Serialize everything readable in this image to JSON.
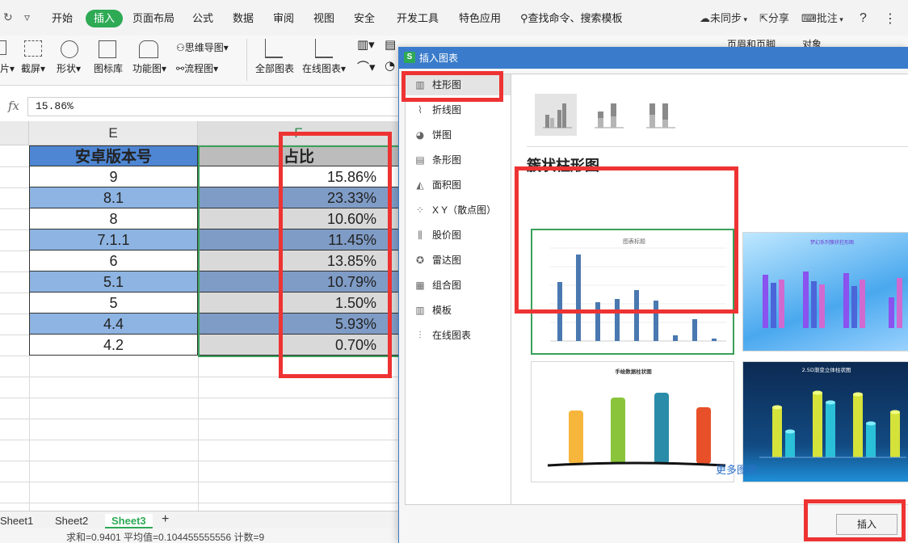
{
  "menubar": {
    "tabs": [
      "开始",
      "插入",
      "页面布局",
      "公式",
      "数据",
      "审阅",
      "视图",
      "安全",
      "开发工具",
      "特色应用"
    ],
    "active_tab": "插入",
    "search": "查找命令、搜索模板",
    "sync": "未同步",
    "share": "分享",
    "comment": "批注",
    "help": "?"
  },
  "ribbon": {
    "screenshot": "截屏",
    "shapes": "形状",
    "icon_library": "图标库",
    "function_chart": "功能图",
    "mindmap": "思维导图",
    "flowchart": "流程图",
    "all_charts": "全部图表",
    "online_charts": "在线图表",
    "header_footer": "页眉和页脚",
    "object": "对象"
  },
  "formula": {
    "fx": "fx",
    "value": "15.86%"
  },
  "sheet": {
    "col_e": "E",
    "col_f": "F",
    "header_e": "安卓版本号",
    "header_f": "占比",
    "rows": [
      {
        "version": "9",
        "pct": "15.86%"
      },
      {
        "version": "8.1",
        "pct": "23.33%"
      },
      {
        "version": "8",
        "pct": "10.60%"
      },
      {
        "version": "7.1.1",
        "pct": "11.45%"
      },
      {
        "version": "6",
        "pct": "13.85%"
      },
      {
        "version": "5.1",
        "pct": "10.79%"
      },
      {
        "version": "5",
        "pct": "1.50%"
      },
      {
        "version": "4.4",
        "pct": "5.93%"
      },
      {
        "version": "4.2",
        "pct": "0.70%"
      }
    ],
    "tabs": [
      "Sheet1",
      "Sheet2",
      "Sheet3"
    ],
    "active_tab": "Sheet3",
    "add_sheet": "+",
    "status": "求和=0.9401   平均值=0.104455555556   计数=9"
  },
  "dialog": {
    "title": "插入图表",
    "logo": "S",
    "chart_types": [
      {
        "label": "柱形图",
        "icon": "column-chart-icon"
      },
      {
        "label": "折线图",
        "icon": "line-chart-icon"
      },
      {
        "label": "饼图",
        "icon": "pie-chart-icon"
      },
      {
        "label": "条形图",
        "icon": "bar-chart-icon"
      },
      {
        "label": "面积图",
        "icon": "area-chart-icon"
      },
      {
        "label": "X Y（散点图）",
        "icon": "scatter-chart-icon"
      },
      {
        "label": "股价图",
        "icon": "stock-chart-icon"
      },
      {
        "label": "雷达图",
        "icon": "radar-chart-icon"
      },
      {
        "label": "组合图",
        "icon": "combo-chart-icon"
      },
      {
        "label": "模板",
        "icon": "template-icon"
      },
      {
        "label": "在线图表",
        "icon": "online-chart-icon"
      }
    ],
    "active_type": "柱形图",
    "section_title": "簇状柱形图",
    "thumbnails": {
      "default_title": "图表标题",
      "gradient_title": "梦幻系列簇状柱形图",
      "hand_title": "手绘数据柱状图",
      "cyl_title": "2.5D渐变立体柱状图"
    },
    "more": "更多图表......",
    "insert": "插入",
    "accent": "#3a7ccb"
  },
  "highlight_color": "#ee3333",
  "brand_color": "#2eaa55"
}
